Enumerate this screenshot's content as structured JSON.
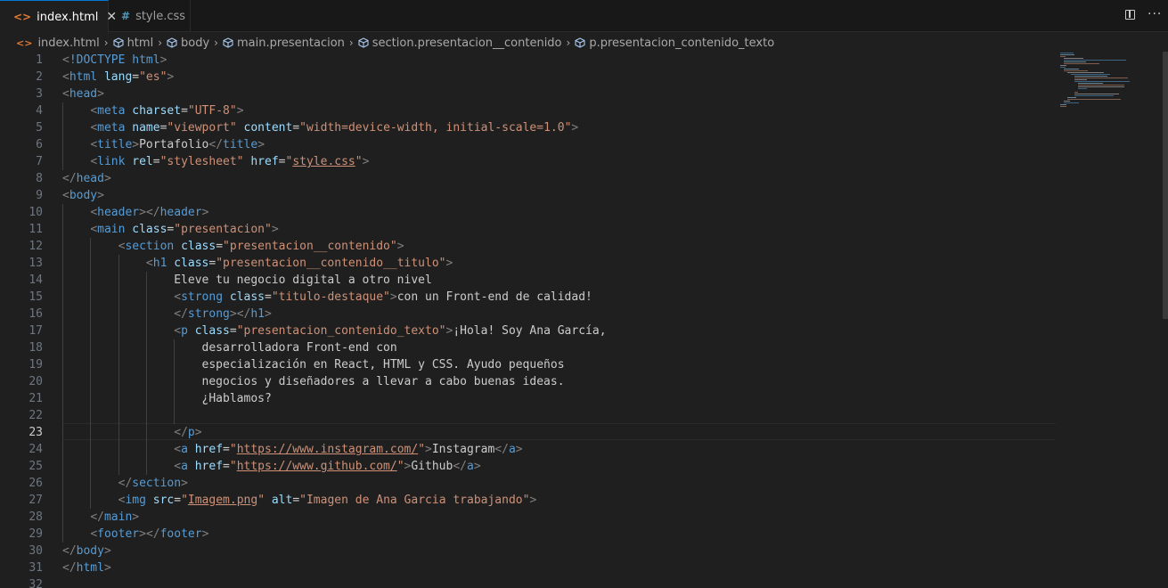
{
  "tabs": [
    {
      "icon": "html-icon",
      "icon_text": "<>",
      "label": "index.html",
      "close": "✕"
    },
    {
      "icon": "css-icon",
      "icon_text": "#",
      "label": "style.css"
    }
  ],
  "actions": {
    "more": "···"
  },
  "breadcrumb": [
    {
      "label": "index.html",
      "icon": "html-file-icon",
      "icon_text": "<>"
    },
    {
      "label": "html",
      "icon": "symbol-icon"
    },
    {
      "label": "body",
      "icon": "symbol-icon"
    },
    {
      "label": "main.presentacion",
      "icon": "symbol-icon"
    },
    {
      "label": "section.presentacion__contenido",
      "icon": "symbol-icon"
    },
    {
      "label": "p.presentacion_contenido_texto",
      "icon": "symbol-icon"
    }
  ],
  "editor": {
    "current_line": 23,
    "line_numbers": [
      "1",
      "2",
      "3",
      "4",
      "5",
      "6",
      "7",
      "8",
      "9",
      "10",
      "11",
      "12",
      "13",
      "14",
      "15",
      "16",
      "17",
      "18",
      "19",
      "20",
      "21",
      "22",
      "23",
      "24",
      "25",
      "26",
      "27",
      "28",
      "29",
      "30",
      "31",
      "32"
    ],
    "lines": [
      "<!DOCTYPE html>",
      "<html lang=\"es\">",
      "<head>",
      "    <meta charset=\"UTF-8\">",
      "    <meta name=\"viewport\" content=\"width=device-width, initial-scale=1.0\">",
      "    <title>Portafolio</title>",
      "    <link rel=\"stylesheet\" href=\"style.css\">",
      "</head>",
      "<body>",
      "    <header></header>",
      "    <main class=\"presentacion\">",
      "        <section class=\"presentacion__contenido\">",
      "            <h1 class=\"presentacion__contenido__titulo\">",
      "                Eleve tu negocio digital a otro nivel",
      "                <strong class=\"titulo-destaque\">con un Front-end de calidad!",
      "                </strong></h1>",
      "                <p class=\"presentacion_contenido_texto\">¡Hola! Soy Ana García,",
      "                    desarrolladora Front-end con",
      "                    especialización en React, HTML y CSS. Ayudo pequeños",
      "                    negocios y diseñadores a llevar a cabo buenas ideas.",
      "                    ¿Hablamos?",
      "",
      "                </p>",
      "                <a href=\"https://www.instagram.com/\">Instagram</a>",
      "                <a href=\"https://www.github.com/\">Github</a>",
      "        </section>",
      "        <img src=\"Imagem.png\" alt=\"Imagen de Ana Garcia trabajando\">",
      "    </main>",
      "    <footer></footer>",
      "</body>",
      "</html>",
      ""
    ]
  },
  "colors": {
    "background": "#1f1f1f",
    "tag": "#569cd6",
    "attribute": "#9cdcfe",
    "string": "#ce9178",
    "punctuation": "#808080",
    "text": "#cccccc",
    "accent": "#0078d4",
    "html_icon": "#e37933",
    "css_icon": "#519aba"
  }
}
